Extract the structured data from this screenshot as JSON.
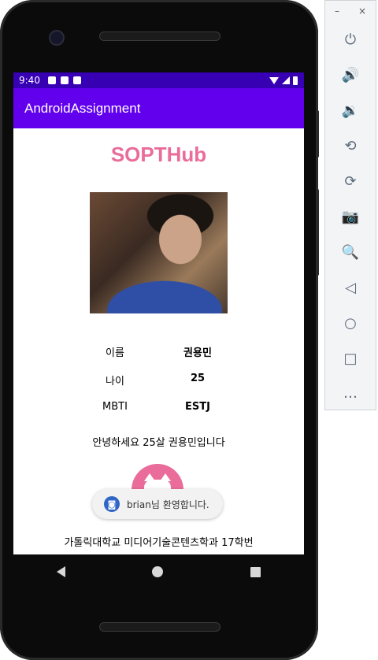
{
  "statusbar": {
    "time": "9:40",
    "color": "#3700b3"
  },
  "appbar": {
    "title": "AndroidAssignment",
    "color": "#6200ee"
  },
  "profile": {
    "brand": "SOPTHub",
    "brand_color": "#ea6c9b",
    "rows": [
      {
        "label": "이름",
        "value": "권용민"
      },
      {
        "label": "나이",
        "value": "25"
      },
      {
        "label": "MBTI",
        "value": "ESTJ"
      }
    ],
    "greeting": "안녕하세요 25살 권용민입니다",
    "footer": "가톨릭대학교 미디어기술콘텐츠학과 17학번"
  },
  "toast": {
    "text": "brian님 환영합니다."
  },
  "navbar": {
    "icons": [
      "back-icon",
      "home-icon",
      "recents-icon"
    ]
  },
  "emulator": {
    "minimize": "–",
    "close": "×",
    "buttons": [
      {
        "icon": "power-icon",
        "glyph": "⏻"
      },
      {
        "icon": "volume-up-icon",
        "glyph": "🔊"
      },
      {
        "icon": "volume-down-icon",
        "glyph": "🔉"
      },
      {
        "icon": "rotate-left-icon",
        "glyph": "⟲"
      },
      {
        "icon": "rotate-right-icon",
        "glyph": "⟳"
      },
      {
        "icon": "camera-icon",
        "glyph": "📷"
      },
      {
        "icon": "zoom-icon",
        "glyph": "🔍"
      },
      {
        "icon": "back-icon",
        "glyph": "◁"
      },
      {
        "icon": "home-icon",
        "glyph": "○"
      },
      {
        "icon": "overview-icon",
        "glyph": "□"
      },
      {
        "icon": "more-icon",
        "glyph": "…"
      }
    ]
  }
}
